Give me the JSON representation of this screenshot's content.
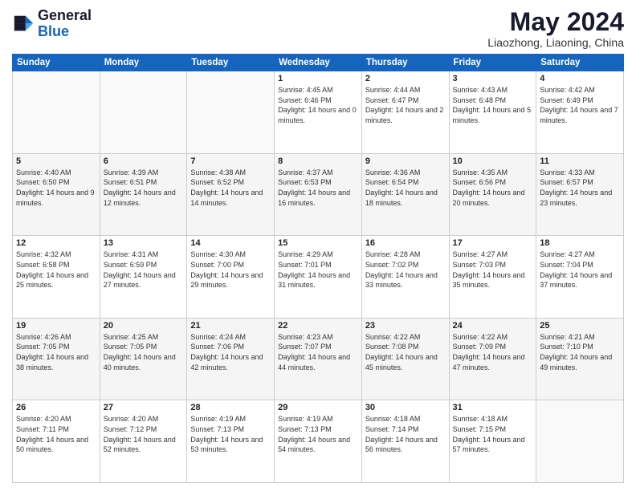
{
  "header": {
    "logo_line1": "General",
    "logo_line2": "Blue",
    "title": "May 2024",
    "subtitle": "Liaozhong, Liaoning, China"
  },
  "calendar": {
    "weekdays": [
      "Sunday",
      "Monday",
      "Tuesday",
      "Wednesday",
      "Thursday",
      "Friday",
      "Saturday"
    ],
    "weeks": [
      [
        {
          "day": "",
          "info": ""
        },
        {
          "day": "",
          "info": ""
        },
        {
          "day": "",
          "info": ""
        },
        {
          "day": "1",
          "info": "Sunrise: 4:45 AM\nSunset: 6:46 PM\nDaylight: 14 hours\nand 0 minutes."
        },
        {
          "day": "2",
          "info": "Sunrise: 4:44 AM\nSunset: 6:47 PM\nDaylight: 14 hours\nand 2 minutes."
        },
        {
          "day": "3",
          "info": "Sunrise: 4:43 AM\nSunset: 6:48 PM\nDaylight: 14 hours\nand 5 minutes."
        },
        {
          "day": "4",
          "info": "Sunrise: 4:42 AM\nSunset: 6:49 PM\nDaylight: 14 hours\nand 7 minutes."
        }
      ],
      [
        {
          "day": "5",
          "info": "Sunrise: 4:40 AM\nSunset: 6:50 PM\nDaylight: 14 hours\nand 9 minutes."
        },
        {
          "day": "6",
          "info": "Sunrise: 4:39 AM\nSunset: 6:51 PM\nDaylight: 14 hours\nand 12 minutes."
        },
        {
          "day": "7",
          "info": "Sunrise: 4:38 AM\nSunset: 6:52 PM\nDaylight: 14 hours\nand 14 minutes."
        },
        {
          "day": "8",
          "info": "Sunrise: 4:37 AM\nSunset: 6:53 PM\nDaylight: 14 hours\nand 16 minutes."
        },
        {
          "day": "9",
          "info": "Sunrise: 4:36 AM\nSunset: 6:54 PM\nDaylight: 14 hours\nand 18 minutes."
        },
        {
          "day": "10",
          "info": "Sunrise: 4:35 AM\nSunset: 6:56 PM\nDaylight: 14 hours\nand 20 minutes."
        },
        {
          "day": "11",
          "info": "Sunrise: 4:33 AM\nSunset: 6:57 PM\nDaylight: 14 hours\nand 23 minutes."
        }
      ],
      [
        {
          "day": "12",
          "info": "Sunrise: 4:32 AM\nSunset: 6:58 PM\nDaylight: 14 hours\nand 25 minutes."
        },
        {
          "day": "13",
          "info": "Sunrise: 4:31 AM\nSunset: 6:59 PM\nDaylight: 14 hours\nand 27 minutes."
        },
        {
          "day": "14",
          "info": "Sunrise: 4:30 AM\nSunset: 7:00 PM\nDaylight: 14 hours\nand 29 minutes."
        },
        {
          "day": "15",
          "info": "Sunrise: 4:29 AM\nSunset: 7:01 PM\nDaylight: 14 hours\nand 31 minutes."
        },
        {
          "day": "16",
          "info": "Sunrise: 4:28 AM\nSunset: 7:02 PM\nDaylight: 14 hours\nand 33 minutes."
        },
        {
          "day": "17",
          "info": "Sunrise: 4:27 AM\nSunset: 7:03 PM\nDaylight: 14 hours\nand 35 minutes."
        },
        {
          "day": "18",
          "info": "Sunrise: 4:27 AM\nSunset: 7:04 PM\nDaylight: 14 hours\nand 37 minutes."
        }
      ],
      [
        {
          "day": "19",
          "info": "Sunrise: 4:26 AM\nSunset: 7:05 PM\nDaylight: 14 hours\nand 38 minutes."
        },
        {
          "day": "20",
          "info": "Sunrise: 4:25 AM\nSunset: 7:05 PM\nDaylight: 14 hours\nand 40 minutes."
        },
        {
          "day": "21",
          "info": "Sunrise: 4:24 AM\nSunset: 7:06 PM\nDaylight: 14 hours\nand 42 minutes."
        },
        {
          "day": "22",
          "info": "Sunrise: 4:23 AM\nSunset: 7:07 PM\nDaylight: 14 hours\nand 44 minutes."
        },
        {
          "day": "23",
          "info": "Sunrise: 4:22 AM\nSunset: 7:08 PM\nDaylight: 14 hours\nand 45 minutes."
        },
        {
          "day": "24",
          "info": "Sunrise: 4:22 AM\nSunset: 7:09 PM\nDaylight: 14 hours\nand 47 minutes."
        },
        {
          "day": "25",
          "info": "Sunrise: 4:21 AM\nSunset: 7:10 PM\nDaylight: 14 hours\nand 49 minutes."
        }
      ],
      [
        {
          "day": "26",
          "info": "Sunrise: 4:20 AM\nSunset: 7:11 PM\nDaylight: 14 hours\nand 50 minutes."
        },
        {
          "day": "27",
          "info": "Sunrise: 4:20 AM\nSunset: 7:12 PM\nDaylight: 14 hours\nand 52 minutes."
        },
        {
          "day": "28",
          "info": "Sunrise: 4:19 AM\nSunset: 7:13 PM\nDaylight: 14 hours\nand 53 minutes."
        },
        {
          "day": "29",
          "info": "Sunrise: 4:19 AM\nSunset: 7:13 PM\nDaylight: 14 hours\nand 54 minutes."
        },
        {
          "day": "30",
          "info": "Sunrise: 4:18 AM\nSunset: 7:14 PM\nDaylight: 14 hours\nand 56 minutes."
        },
        {
          "day": "31",
          "info": "Sunrise: 4:18 AM\nSunset: 7:15 PM\nDaylight: 14 hours\nand 57 minutes."
        },
        {
          "day": "",
          "info": ""
        }
      ]
    ]
  }
}
